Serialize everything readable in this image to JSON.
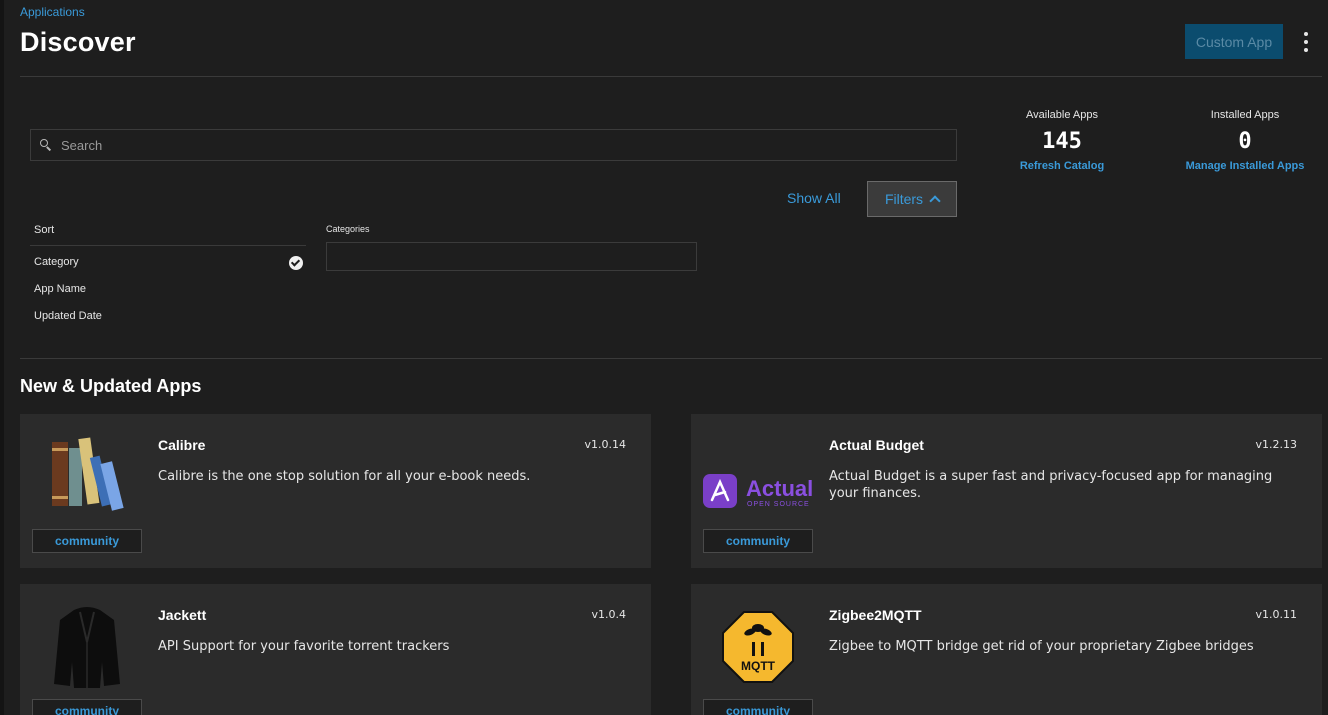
{
  "header": {
    "breadcrumb": "Applications",
    "title": "Discover",
    "custom_app_label": "Custom App",
    "kebab_icon": "more-vert-icon"
  },
  "search": {
    "placeholder": "Search",
    "value": ""
  },
  "filters": {
    "show_all_label": "Show All",
    "filters_label": "Filters",
    "sort": {
      "title": "Sort",
      "options": [
        "Category",
        "App Name",
        "Updated Date"
      ],
      "selected": "Category"
    },
    "categories": {
      "label": "Categories",
      "value": ""
    }
  },
  "stats": {
    "available": {
      "label": "Available Apps",
      "value": "145",
      "link": "Refresh Catalog"
    },
    "installed": {
      "label": "Installed Apps",
      "value": "0",
      "link": "Manage Installed Apps"
    }
  },
  "section": {
    "title": "New & Updated Apps"
  },
  "apps": [
    {
      "name": "Calibre",
      "version": "v1.0.14",
      "description": "Calibre is the one stop solution for all your e-book needs.",
      "train": "community"
    },
    {
      "name": "Actual Budget",
      "version": "v1.2.13",
      "description": "Actual Budget is a super fast and privacy-focused app for managing your finances.",
      "train": "community",
      "logo_text": "Actual",
      "logo_subtext": "OPEN SOURCE"
    },
    {
      "name": "Jackett",
      "version": "v1.0.4",
      "description": "API Support for your favorite torrent trackers",
      "train": "community"
    },
    {
      "name": "Zigbee2MQTT",
      "version": "v1.0.11",
      "description": "Zigbee to MQTT bridge get rid of your proprietary Zigbee bridges",
      "train": "community",
      "logo_text": "MQTT"
    }
  ],
  "colors": {
    "accent": "#3a9ad9",
    "background": "#1e1e1e",
    "card": "#2b2b2b",
    "primary_button": "#0b4c6e"
  }
}
